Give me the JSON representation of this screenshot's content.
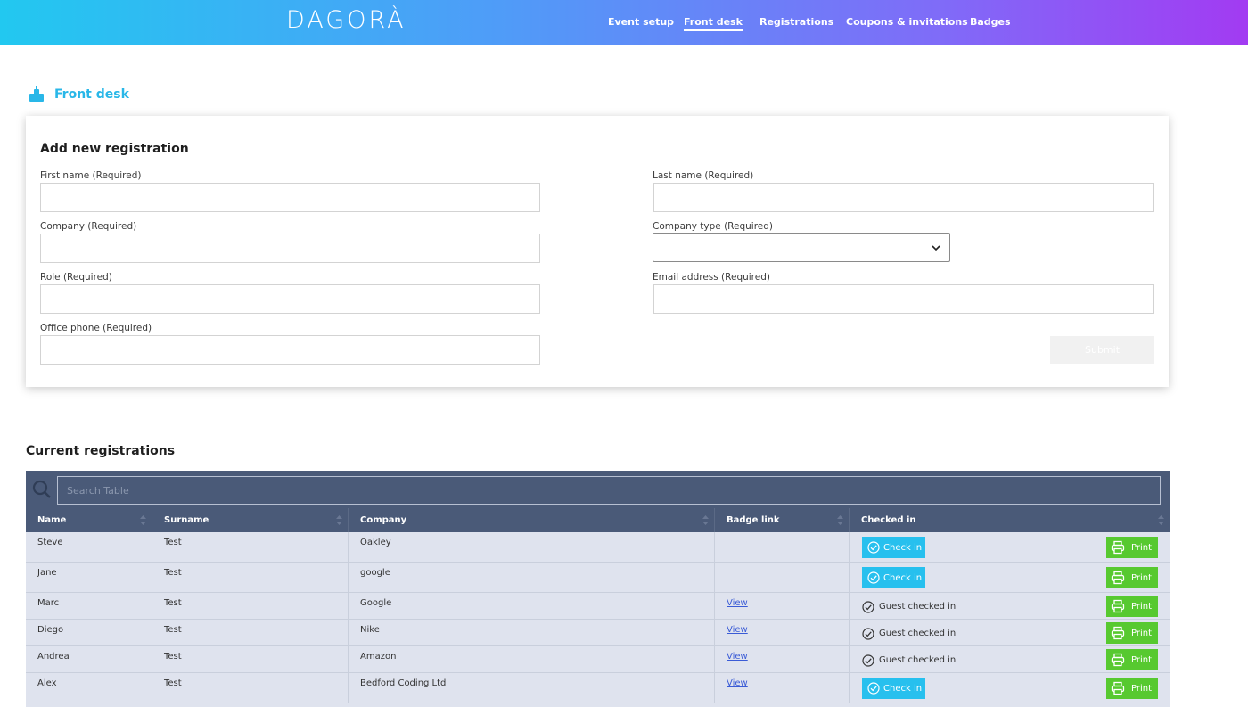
{
  "brand": {
    "logo_text": "DAGORÀ"
  },
  "nav": {
    "items": [
      {
        "label": "Event setup"
      },
      {
        "label": "Front desk",
        "active": true
      },
      {
        "label": "Registrations"
      },
      {
        "label": "Coupons & invitations"
      },
      {
        "label": "Badges"
      }
    ]
  },
  "page": {
    "title": "Front desk",
    "icon": "front-desk-icon"
  },
  "form": {
    "title": "Add new registration",
    "first_name": {
      "label": "First name (Required)",
      "value": ""
    },
    "last_name": {
      "label": "Last name (Required)",
      "value": ""
    },
    "company": {
      "label": "Company (Required)",
      "value": ""
    },
    "company_type": {
      "label": "Company type (Required)",
      "selected": ""
    },
    "role": {
      "label": "Role (Required)",
      "value": ""
    },
    "email": {
      "label": "Email address (Required)",
      "value": ""
    },
    "office_phone": {
      "label": "Office phone (Required)",
      "value": ""
    },
    "submit_label": "Submit"
  },
  "registrations": {
    "title": "Current registrations",
    "search_placeholder": "Search Table",
    "columns": [
      "Name",
      "Surname",
      "Company",
      "Badge link",
      "Checked in"
    ],
    "checkin_label": "Check in",
    "checked_in_label": "Guest checked in",
    "print_label": "Print",
    "rows": [
      {
        "name": "Steve",
        "surname": "Test",
        "company": "Oakley",
        "badge_link": "",
        "checked_in": false
      },
      {
        "name": "Jane",
        "surname": "Test",
        "company": "google",
        "badge_link": "",
        "checked_in": false
      },
      {
        "name": "Marc",
        "surname": "Test",
        "company": "Google",
        "badge_link": "View",
        "checked_in": true
      },
      {
        "name": "Diego",
        "surname": "Test",
        "company": "Nike",
        "badge_link": "View",
        "checked_in": true
      },
      {
        "name": "Andrea",
        "surname": "Test",
        "company": "Amazon",
        "badge_link": "View",
        "checked_in": true
      },
      {
        "name": "Alex",
        "surname": "Test",
        "company": "Bedford Coding Ltd",
        "badge_link": "View",
        "checked_in": false
      }
    ]
  },
  "colors": {
    "accent": "#29b7e8",
    "table_header": "#4a5a78",
    "checkin_button": "#27c0ee",
    "print_button": "#57c930"
  }
}
